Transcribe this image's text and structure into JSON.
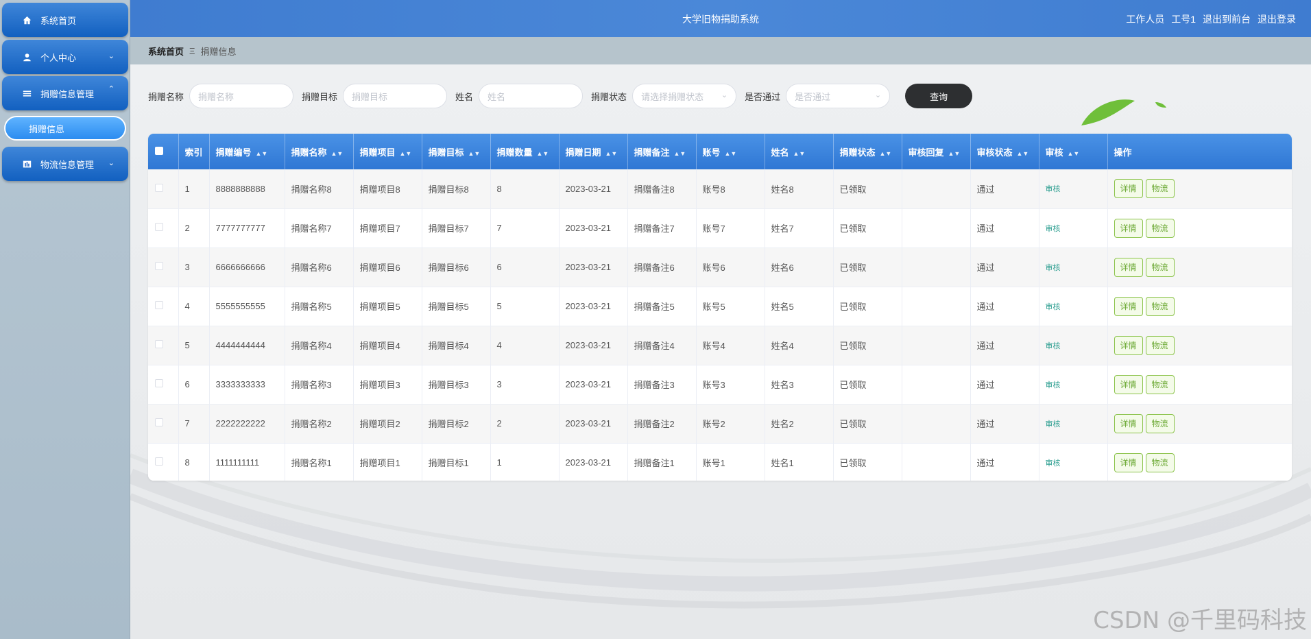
{
  "header": {
    "title": "大学旧物捐助系统",
    "user_role": "工作人员",
    "user_name": "工号1",
    "front_link": "退出到前台",
    "logout_link": "退出登录"
  },
  "sidebar": {
    "items": [
      {
        "label": "系统首页",
        "icon": "home-icon"
      },
      {
        "label": "个人中心",
        "icon": "user-icon"
      },
      {
        "label": "捐赠信息管理",
        "icon": "list-icon"
      },
      {
        "label": "物流信息管理",
        "icon": "chart-icon"
      }
    ],
    "sub_item": "捐赠信息"
  },
  "breadcrumb": {
    "home": "系统首页",
    "separator": "Ξ",
    "current": "捐赠信息"
  },
  "search": {
    "name_label": "捐赠名称",
    "name_placeholder": "捐赠名称",
    "target_label": "捐赠目标",
    "target_placeholder": "捐赠目标",
    "person_label": "姓名",
    "person_placeholder": "姓名",
    "status_label": "捐赠状态",
    "status_placeholder": "请选择捐赠状态",
    "pass_label": "是否通过",
    "pass_placeholder": "是否通过",
    "query_button": "查询"
  },
  "table": {
    "columns": [
      "索引",
      "捐赠编号",
      "捐赠名称",
      "捐赠项目",
      "捐赠目标",
      "捐赠数量",
      "捐赠日期",
      "捐赠备注",
      "账号",
      "姓名",
      "捐赠状态",
      "审核回复",
      "审核状态",
      "审核",
      "操作"
    ],
    "audit_label": "审核",
    "detail_label": "详情",
    "logistics_label": "物流",
    "rows": [
      {
        "idx": "1",
        "code": "8888888888",
        "name": "捐赠名称8",
        "project": "捐赠项目8",
        "target": "捐赠目标8",
        "qty": "8",
        "date": "2023-03-21",
        "remark": "捐赠备注8",
        "account": "账号8",
        "person": "姓名8",
        "status": "已领取",
        "reply": "",
        "audit_status": "通过"
      },
      {
        "idx": "2",
        "code": "7777777777",
        "name": "捐赠名称7",
        "project": "捐赠项目7",
        "target": "捐赠目标7",
        "qty": "7",
        "date": "2023-03-21",
        "remark": "捐赠备注7",
        "account": "账号7",
        "person": "姓名7",
        "status": "已领取",
        "reply": "",
        "audit_status": "通过"
      },
      {
        "idx": "3",
        "code": "6666666666",
        "name": "捐赠名称6",
        "project": "捐赠项目6",
        "target": "捐赠目标6",
        "qty": "6",
        "date": "2023-03-21",
        "remark": "捐赠备注6",
        "account": "账号6",
        "person": "姓名6",
        "status": "已领取",
        "reply": "",
        "audit_status": "通过"
      },
      {
        "idx": "4",
        "code": "5555555555",
        "name": "捐赠名称5",
        "project": "捐赠项目5",
        "target": "捐赠目标5",
        "qty": "5",
        "date": "2023-03-21",
        "remark": "捐赠备注5",
        "account": "账号5",
        "person": "姓名5",
        "status": "已领取",
        "reply": "",
        "audit_status": "通过"
      },
      {
        "idx": "5",
        "code": "4444444444",
        "name": "捐赠名称4",
        "project": "捐赠项目4",
        "target": "捐赠目标4",
        "qty": "4",
        "date": "2023-03-21",
        "remark": "捐赠备注4",
        "account": "账号4",
        "person": "姓名4",
        "status": "已领取",
        "reply": "",
        "audit_status": "通过"
      },
      {
        "idx": "6",
        "code": "3333333333",
        "name": "捐赠名称3",
        "project": "捐赠项目3",
        "target": "捐赠目标3",
        "qty": "3",
        "date": "2023-03-21",
        "remark": "捐赠备注3",
        "account": "账号3",
        "person": "姓名3",
        "status": "已领取",
        "reply": "",
        "audit_status": "通过"
      },
      {
        "idx": "7",
        "code": "2222222222",
        "name": "捐赠名称2",
        "project": "捐赠项目2",
        "target": "捐赠目标2",
        "qty": "2",
        "date": "2023-03-21",
        "remark": "捐赠备注2",
        "account": "账号2",
        "person": "姓名2",
        "status": "已领取",
        "reply": "",
        "audit_status": "通过"
      },
      {
        "idx": "8",
        "code": "1111111111",
        "name": "捐赠名称1",
        "project": "捐赠项目1",
        "target": "捐赠目标1",
        "qty": "1",
        "date": "2023-03-21",
        "remark": "捐赠备注1",
        "account": "账号1",
        "person": "姓名1",
        "status": "已领取",
        "reply": "",
        "audit_status": "通过"
      }
    ]
  },
  "watermark": "CSDN @千里码科技",
  "colors": {
    "header_blue": "#3f7cd0",
    "menu_blue": "#1260c0",
    "table_header": "#2f77d4",
    "query_button": "#2d2f31",
    "op_green": "#6aa832",
    "audit_teal": "#2a9d8f"
  }
}
